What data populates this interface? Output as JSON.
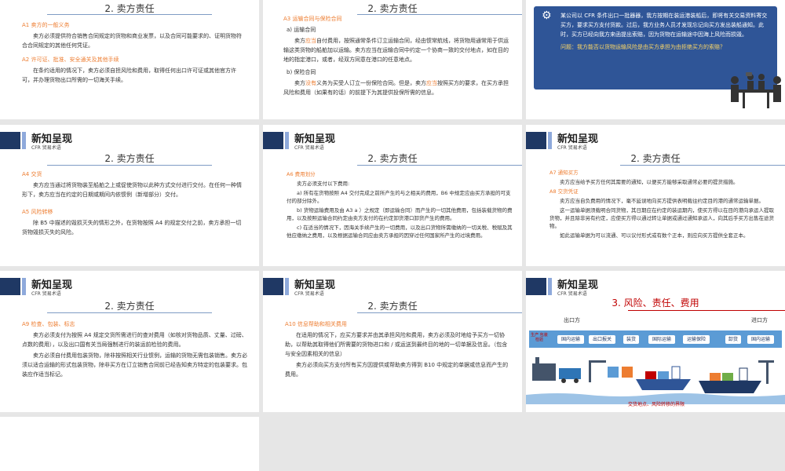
{
  "colors": {
    "accent": "#ed7d31",
    "navy": "#1f3864",
    "case_bg": "#2f5597",
    "red": "#c00000"
  },
  "s1": {
    "sub": "2. 卖方责任",
    "h1": "A1 卖方的一般义务",
    "p1": "卖方必须提供符合销售合同规定的货物和商业发票，以及合同可能要求的、证明货物符合合同规定的其他任何凭证。",
    "h2": "A2 许可证、批准、安全通关及其他手续",
    "p2": "在条约适用的情况下，卖方必须自担风险和费用，取得任何出口许可证或其他官方许可，并办理货物出口所需的一切海关手续。"
  },
  "s2": {
    "sub": "2. 卖方责任",
    "h": "A3 运输合同与保险合同",
    "a_title": "a) 运输合同",
    "a_pre": "卖方",
    "a_hl": "应当",
    "a_post": "自付费用，按照通常条件订立运输合同，经由惯常航线，将货物用通常用于供运输这类货物的船舶加以运输。卖方应当在运输合同中约定一个协商一致的交付地点，如在目的地的指定港口，或者，经双方同意在港口的任意地点。",
    "b_title": "b) 保险合同",
    "b_pre": "卖方",
    "b_hl": "没有",
    "b_mid": "义务为买受人订立一份保险合同。但是，卖方",
    "b_hl2": "应当",
    "b_post": "按照买方的要求，在买方承担风险和费用（如果有的话）的前提下为其提供投保所需的信息。"
  },
  "s3": {
    "case_text": "某公司以 CFR 条件出口一批器器，我方按期在装运港装船后，即将有关交易资料寄交买方，要求买方支付货款。过后，我方业务人员才发现忘记向买方发出装船通知。此时，买方已经向我方来函提出索赔，因为货物在运输途中因海上风险而损毁。",
    "question": "问题：我方能否以货物运输风险是由买方承担为由拒绝买方的索赔？"
  },
  "hdr": {
    "t1": "新知呈现",
    "t2": "CFR 贸易术语"
  },
  "s4": {
    "sub": "2. 卖方责任",
    "h1": "A4  交货",
    "p1": "卖方应当通过将货物装至船舶之上或促使货物以此种方式交付进行交付。在任何一种情形下，卖方应当在约定的日期或期间内依惯例（新增部分）交付。",
    "h2": "A5 风险转移",
    "p2": "除 B5 中描述的毁损灭失的情形之外，在货物按照 A4 的规定交付之前，卖方承担一切货物毁损灭失的风险。"
  },
  "s5": {
    "sub": "2. 卖方责任",
    "h": "A6  费用划分",
    "intro": "卖方必须支付以下费用:",
    "a": "a) 所有在货物按照 A4 交付完成之前所产生的与之相关的费用，B6 中规定应由买方承担的可支付的部分除外。",
    "b": "b) 货物运输费用及由 A3 a ）之规定（即运输合同）而产生的一切其他费用，包括装载货物的费用，以及按照运输合同约定由卖方支付的在约定卸货港口卸货产生的费用。",
    "c": "c) 在适当的情况下，因海关手续产生的一切费用，以及出口货物所需缴纳的一切关税、税赋及其他应缴纳之费用，以及根据运输合同应由卖方承担的因穿过任何国家所产生的过境费用。"
  },
  "s6": {
    "sub": "2. 卖方责任",
    "h1": "A7 通知买方",
    "p1": "卖方应当给予买方任何其需要的通知，以便买方能够采取通常必要的提货措施。",
    "h2": "A8 交货凭证",
    "p2": "卖方应当自负费用的情况下，毫不延误地向买方提供表明载往约定目的港的通常运输单据。",
    "p3": "这一运输单据须载明合同货物，其日期应在约定的装运期内，使买方得以在目的港向承运人提取货物，并且除非另有约定，应使买方得以通过转让单据或通过通知承运人，向其后手买方出售在途货物。",
    "p4": "如此运输单据为可以流通、可以议付形式或有数个正本，则应向买方提供全套正本。"
  },
  "s7": {
    "sub": "2. 卖方责任",
    "h1": "A9  检查、包装、标志",
    "p1": "卖方必须支付为按照 A4 规定交货所需进行的查对费用（如核对货物品质、丈量、过磅、点数的费用），以及出口国有关当局强制进行的装运前检验的费用。",
    "p2": "卖方必须自付费用包装货物，除非按照相关行业惯例，运输的货物无需包装销售。卖方必须以适合运输的形式包装货物，除非买方在订立销售合同前已经告知卖方特定的包装要求。包装应作适当标记。"
  },
  "s8": {
    "sub": "2. 卖方责任",
    "h": "A10 信息帮助和相关费用",
    "p1": "在适用的情况下，应买方要求并由其承担风险和费用，卖方必须及时地给予买方一切协助，以帮助其取得他们所需要的货物进口和 / 或运送到最终目的地的一切单据及信息。（包含与安全因素相关的信息）",
    "p2": "卖方必须向买方支付所有买方因提供或帮助卖方得到 B10 中规定的单据或信息而产生的费用。"
  },
  "s9": {
    "title": "3. 风险、责任、费用",
    "exporter": "出口方",
    "importer": "进口方",
    "steps": [
      "生产 包装 检验",
      "国内运输",
      "出口报关",
      "装货",
      "国际运输",
      "运输保险",
      "卸货",
      "国内运输"
    ],
    "note": "交货地点、风险转移的界限"
  }
}
